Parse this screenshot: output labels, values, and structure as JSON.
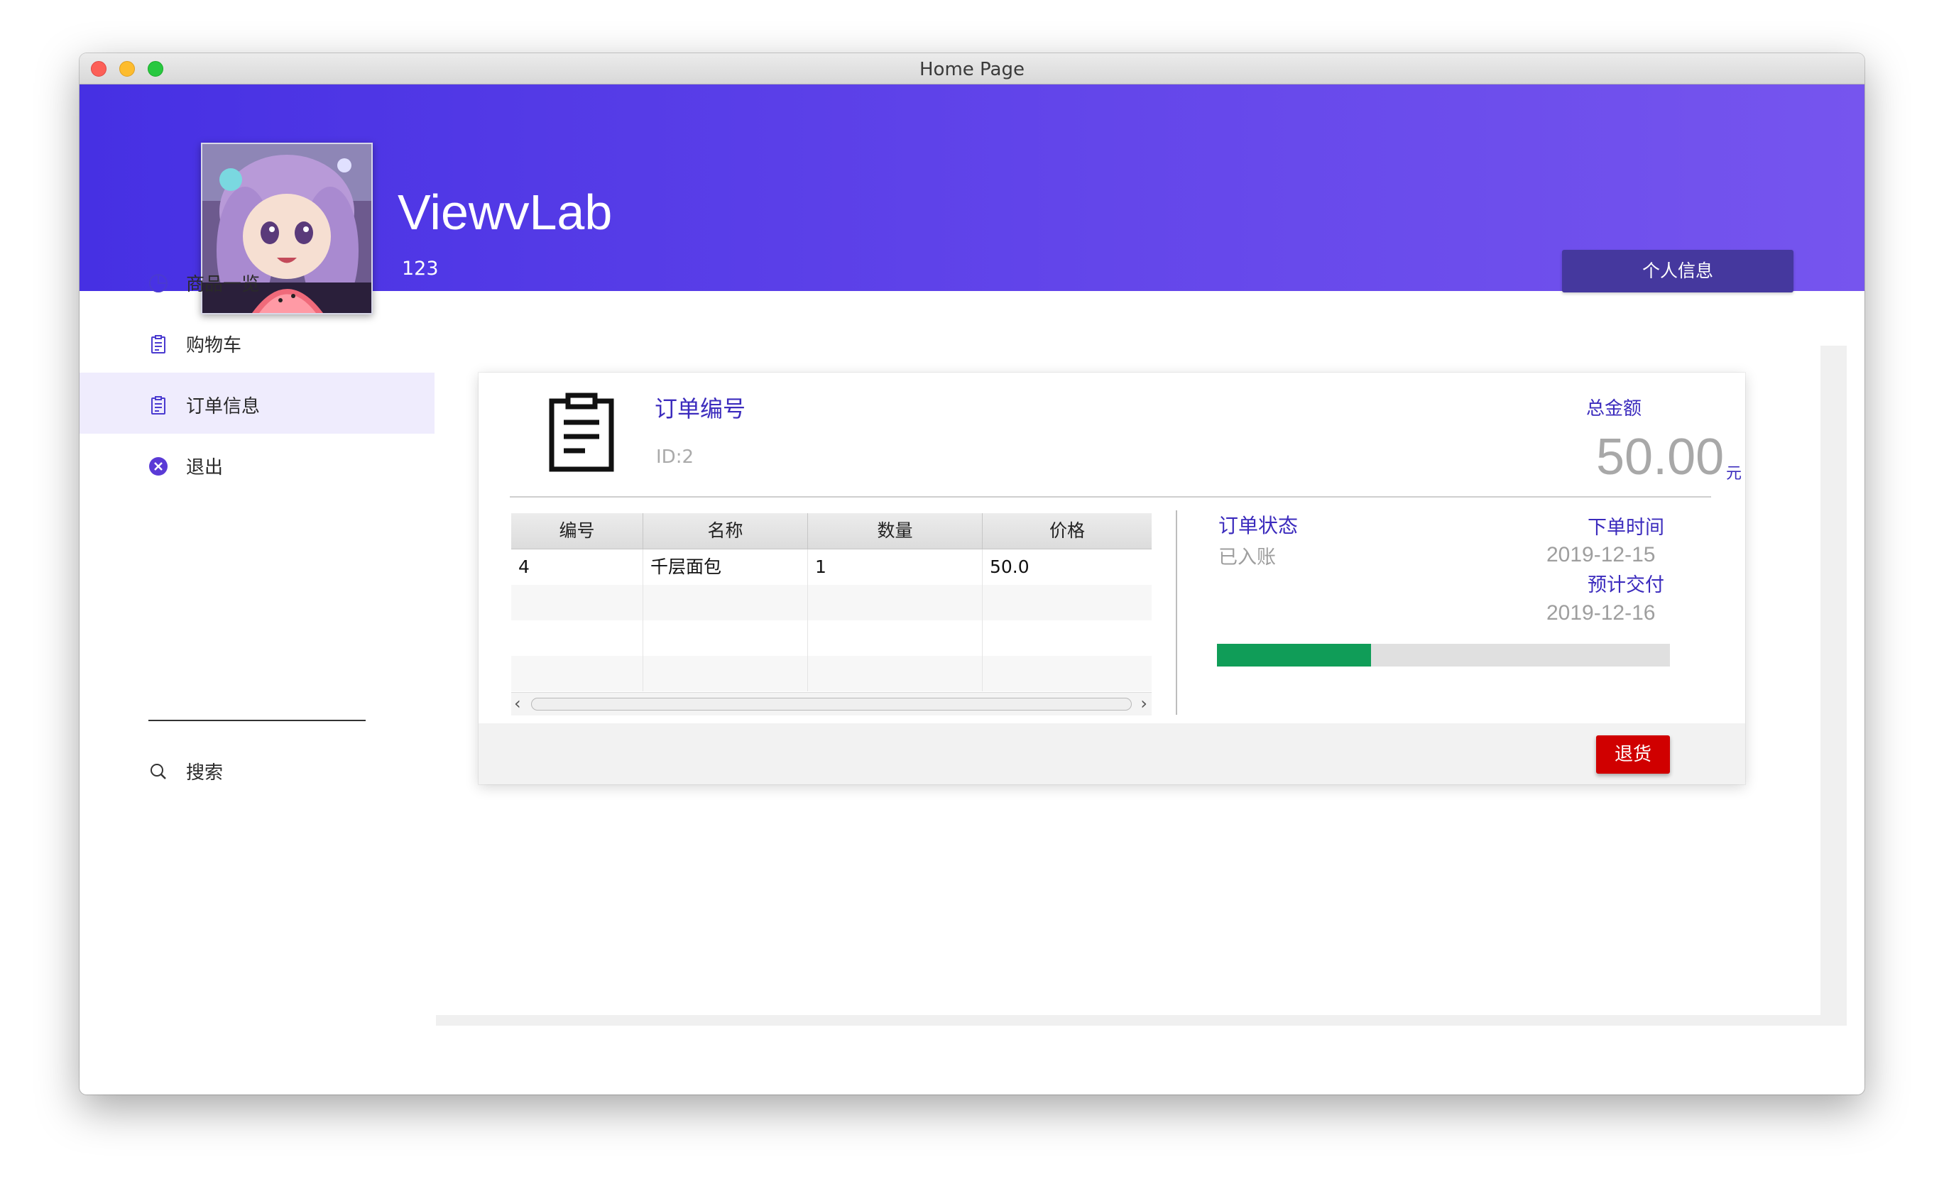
{
  "window": {
    "title": "Home Page"
  },
  "header": {
    "app_name": "ViewvLab",
    "subtitle": "123",
    "profile_button": "个人信息"
  },
  "sidebar": {
    "items": [
      {
        "label": "商品一览",
        "icon": "pie-chart-icon"
      },
      {
        "label": "购物车",
        "icon": "clipboard-icon"
      },
      {
        "label": "订单信息",
        "icon": "clipboard-icon",
        "active": true
      },
      {
        "label": "退出",
        "icon": "close-circle-icon"
      }
    ],
    "search_label": "搜索"
  },
  "order": {
    "number_label": "订单编号",
    "id": "ID:2",
    "total_label": "总金额",
    "total_amount": "50.00",
    "currency": "元",
    "table": {
      "headers": [
        "编号",
        "名称",
        "数量",
        "价格"
      ],
      "rows": [
        [
          "4",
          "千层面包",
          "1",
          "50.0"
        ]
      ]
    },
    "status_label": "订单状态",
    "status_value": "已入账",
    "order_time_label": "下单时间",
    "order_time": "2019-12-15",
    "delivery_label": "预计交付",
    "delivery_time": "2019-12-16",
    "progress": 0.34,
    "return_button": "退货"
  },
  "colors": {
    "accent": "#3b2bbd",
    "header_start": "#4630e3",
    "header_end": "#7655ee",
    "progress": "#109d58",
    "danger": "#d00000"
  }
}
